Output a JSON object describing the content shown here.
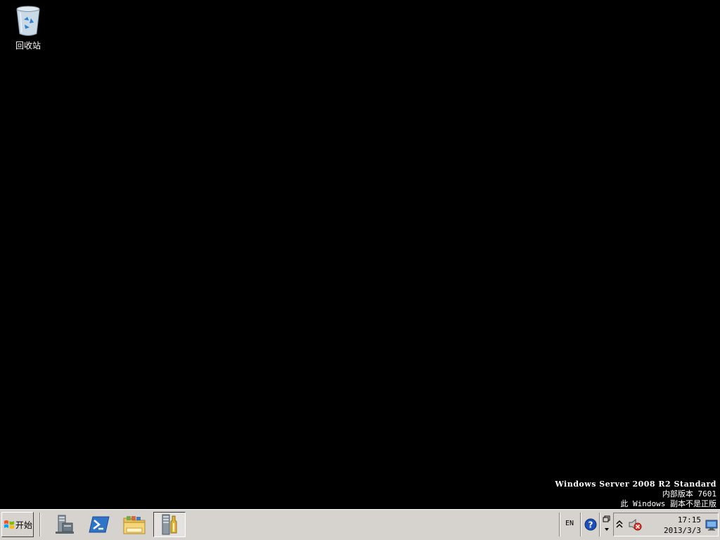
{
  "desktop": {
    "icons": [
      {
        "label": "回收站",
        "icon": "recycle-bin-icon"
      }
    ],
    "watermark": {
      "os": "Windows Server 2008 R2 Standard",
      "build": "内部版本 7601",
      "notice": "此 Windows 副本不是正版"
    }
  },
  "taskbar": {
    "start_label": "开始",
    "pinned": [
      {
        "icon": "server-manager-icon"
      },
      {
        "icon": "powershell-icon"
      },
      {
        "icon": "file-explorer-icon"
      },
      {
        "icon": "tools-icon",
        "active": true
      }
    ],
    "tray": {
      "language": "EN",
      "time": "17:15",
      "date": "2013/3/3"
    }
  },
  "colors": {
    "desktop_bg": "#000000",
    "taskbar_bg": "#d6d3ce"
  }
}
